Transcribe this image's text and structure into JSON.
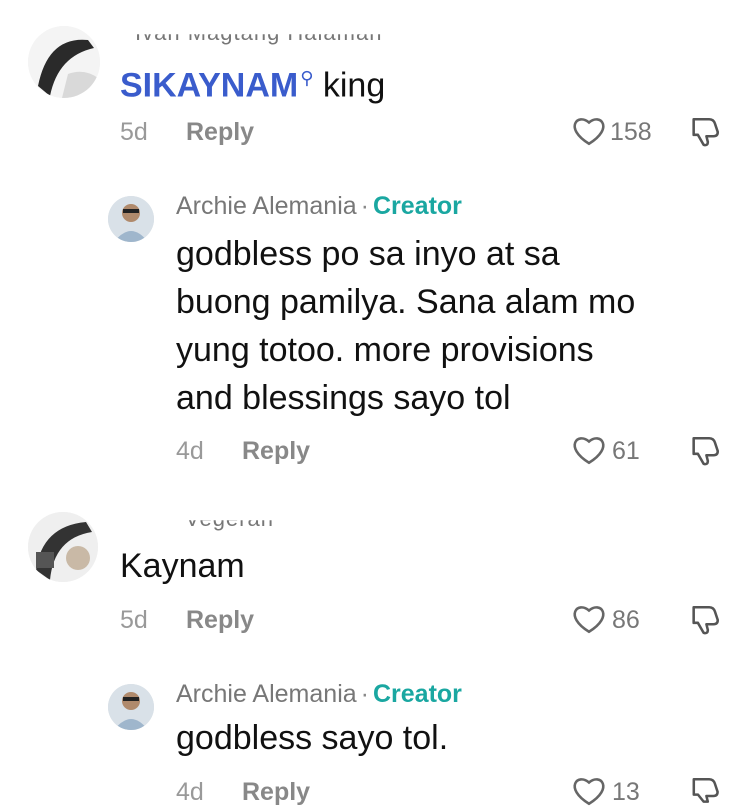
{
  "comments": [
    {
      "author_partial": "Ivan Magtang Halaman",
      "mention": "SIKAYNAM",
      "text": "king",
      "time": "5d",
      "reply_label": "Reply",
      "likes": "158",
      "reply": {
        "author": "Archie Alemania",
        "separator": "·",
        "badge": "Creator",
        "lines": [
          "godbless po sa inyo at sa",
          "buong pamilya. Sana alam mo",
          "yung totoo. more provisions",
          "and blessings sayo tol"
        ],
        "time": "4d",
        "reply_label": "Reply",
        "likes": "61"
      }
    },
    {
      "author_partial": "Vegeran",
      "text": "Kaynam",
      "time": "5d",
      "reply_label": "Reply",
      "likes": "86",
      "reply": {
        "author": "Archie Alemania",
        "separator": "·",
        "badge": "Creator",
        "lines": [
          "godbless sayo tol."
        ],
        "time": "4d",
        "reply_label": "Reply",
        "likes": "13"
      }
    }
  ],
  "colors": {
    "creator": "#1aa7a1",
    "mention": "#3a5ccc",
    "muted": "#999999"
  },
  "icons": {
    "like": "heart-outline-icon",
    "dislike": "thumbs-down-icon",
    "mention_search": "search-icon"
  }
}
